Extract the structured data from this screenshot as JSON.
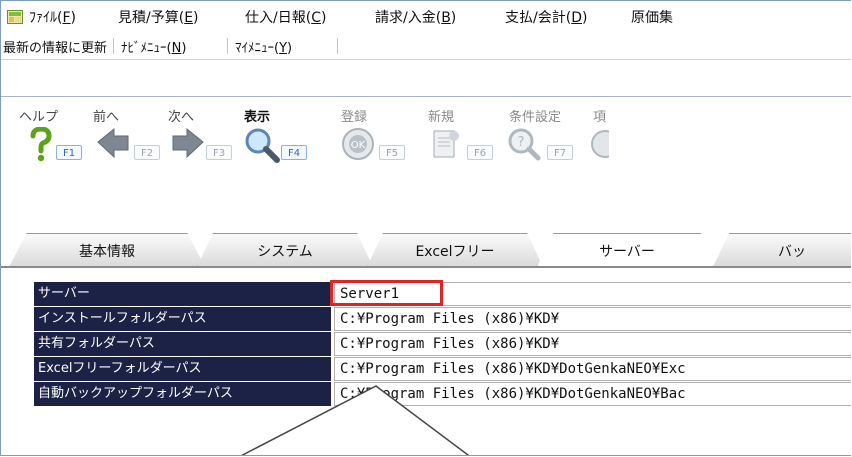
{
  "menu": {
    "items": [
      {
        "text": "ﾌｧｲﾙ(",
        "key": "F",
        "end": ")"
      },
      {
        "text": "見積/予算(",
        "key": "E",
        "end": ")"
      },
      {
        "text": "仕入/日報(",
        "key": "C",
        "end": ")"
      },
      {
        "text": "請求/入金(",
        "key": "B",
        "end": ")"
      },
      {
        "text": "支払/会計(",
        "key": "D",
        "end": ")"
      },
      {
        "text": "原価集",
        "key": "",
        "end": ""
      }
    ]
  },
  "nav": {
    "refresh": "最新の情報に更新",
    "navimenu": {
      "text": "ﾅﾋﾞﾒﾆｭｰ(",
      "key": "N",
      "end": ")"
    },
    "mymenu": {
      "text": "ﾏｲﾒﾆｭｰ(",
      "key": "Y",
      "end": ")"
    }
  },
  "toolbar": {
    "buttons": [
      {
        "label": "ヘルプ",
        "fkey": "F1",
        "icon": "help-icon"
      },
      {
        "label": "前へ",
        "fkey": "F2",
        "icon": "back-arrow-icon"
      },
      {
        "label": "次へ",
        "fkey": "F3",
        "icon": "forward-arrow-icon"
      },
      {
        "label": "表示",
        "fkey": "F4",
        "icon": "magnifier-icon"
      },
      {
        "label": "登録",
        "fkey": "F5",
        "icon": "ok-icon"
      },
      {
        "label": "新規",
        "fkey": "F6",
        "icon": "new-document-icon"
      },
      {
        "label": "条件設定",
        "fkey": "F7",
        "icon": "condition-icon"
      },
      {
        "label": "項",
        "fkey": "",
        "icon": ""
      }
    ]
  },
  "tabs": [
    "基本情報",
    "システム",
    "Excelフリー",
    "サーバー",
    "バッ"
  ],
  "settings": {
    "rows": [
      {
        "label": "サーバー",
        "value": "Server1"
      },
      {
        "label": "インストールフォルダーパス",
        "value": "C:¥Program Files (x86)¥KD¥"
      },
      {
        "label": "共有フォルダーパス",
        "value": "C:¥Program Files (x86)¥KD¥"
      },
      {
        "label": "Excelフリーフォルダーパス",
        "value": "C:¥Program Files (x86)¥KD¥DotGenkaNEO¥Exc"
      },
      {
        "label": "自動バックアップフォルダーパス",
        "value": "C:¥Program Files (x86)¥KD¥DotGenkaNEO¥Bac"
      }
    ]
  },
  "colors": {
    "label_bg": "#1b2246",
    "highlight": "#e02424",
    "fkey_active": "#2b6db0"
  }
}
